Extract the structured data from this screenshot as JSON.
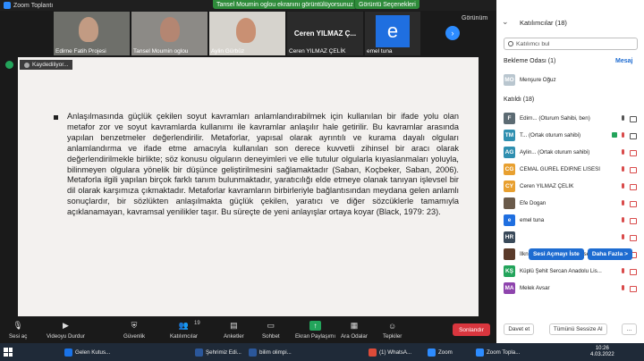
{
  "window": {
    "title": "Zoom Toplantı"
  },
  "banner": {
    "share_text": "Tansel Moumin oglou ekranını görüntülüyorsunuz",
    "view_options": "Görüntü Seçenekleri"
  },
  "thumbnails": [
    {
      "name": "Edirne Fatih Projesi"
    },
    {
      "name": "Tansel Moumin oglou"
    },
    {
      "name": "Aylin Gürbüz"
    },
    {
      "name": "Ceren YILMAZ Ç...",
      "label": "Ceren YILMAZ ÇELİK"
    },
    {
      "name": "e",
      "label": "emel tuna"
    }
  ],
  "view_label": "Görünüm",
  "recording": "Kaydediliyor...",
  "document": {
    "paragraph": "Anlaşılmasında güçlük çekilen soyut kavramları anlamlandırabilmek için kullanılan bir ifade yolu olan metafor zor ve soyut kavramlarda kullanımı ile kavramlar anlaşılır hale getirilir. Bu kavramlar arasında yapılan benzetmeler değerlendirilir. Metaforlar, yapısal olarak ayrıntılı ve kurama dayalı olguları anlamlandırma ve ifade etme amacıyla kullanılan son derece kuvvetli zihinsel bir aracı olarak değerlendirilmekle birlikte; söz konusu olguların deneyimleri ve elle tutulur olgularla kıyaslanmaları yoluyla, bilinmeyen olgulara yönelik bir düşünce geliştirilmesini sağlamaktadır (Saban, Koçbeker, Saban, 2006). Metaforla ilgili yapılan birçok farklı tanım bulunmaktadır, yaratıcılığı elde etmeye olanak tanıyan işlevsel bir dil olarak karşımıza çıkmaktadır. Metaforlar kavramların birbirleriyle bağlantısından meydana gelen anlamlı sonuçlardır, bir sözlükten anlaşılmakta güçlük çekilen, yaratıcı ve diğer sözcüklerle tamamıyla açıklanamayan, kavramsal yenilikler taşır. Bu süreçte de yeni anlayışlar ortaya koyar (Black, 1979: 23)."
  },
  "toolbar": {
    "mute": "Sesi aç",
    "video": "Videoyu Durdur",
    "security": "Güvenlik",
    "participants": "Katılımcılar",
    "participants_count": "19",
    "polls": "Anketler",
    "chat": "Sohbet",
    "share": "Ekran Paylaşımı",
    "breakout": "Ara Odalar",
    "reactions": "Tepkiler",
    "end": "Sonlandır"
  },
  "panel": {
    "title": "Katılımcılar (18)",
    "search_placeholder": "Katılımcı bul",
    "waiting_room": "Bekleme Odası (1)",
    "message": "Mesaj",
    "waiting_person": {
      "initials": "MO",
      "name": "Menşure Oğuz"
    },
    "in_call": "Katıldı (18)",
    "participants": [
      {
        "initials": "F",
        "color": "#5c6b73",
        "name": "Edirn...   (Oturum Sahibi, ben)"
      },
      {
        "initials": "TM",
        "color": "#2f8fb0",
        "name": "T...   (Ortak oturum sahibi)"
      },
      {
        "initials": "AG",
        "color": "#2f8fb0",
        "name": "Aylin...   (Ortak oturum sahibi)"
      },
      {
        "initials": "CG",
        "color": "#e8a030",
        "name": "CEMAL GÜREL EDIRNE LİSESİ"
      },
      {
        "initials": "CY",
        "color": "#e8a030",
        "name": "Ceren YILMAZ ÇELİK"
      },
      {
        "initials": "",
        "color": "#6a5a4a",
        "name": "Efe Dogan"
      },
      {
        "initials": "e",
        "color": "#1f6fe0",
        "name": "emel tuna"
      },
      {
        "initials": "HR",
        "color": "#3a4a5a",
        "name": ""
      },
      {
        "initials": "",
        "color": "#5a3a2a",
        "name": "İlknur Ekinci Keşan Fen Lisesi"
      },
      {
        "initials": "KŞ",
        "color": "#23a45b",
        "name": "Küplü Şehit Sercan Anadolu Lis..."
      },
      {
        "initials": "MA",
        "color": "#8e44ad",
        "name": "Melek Avsar"
      }
    ],
    "ask_unmute": "Sesi Açmayı İste",
    "more": "Daha Fazla >",
    "invite": "Davet et",
    "mute_all": "Tümünü Sessize Al"
  },
  "taskbar": {
    "items": [
      {
        "label": "Gelen Kutus...",
        "color": "#1a73e8"
      },
      {
        "label": "Şehrimiz Edi...",
        "color": "#2b579a"
      },
      {
        "label": "bilim olimpi...",
        "color": "#2b579a"
      },
      {
        "label": "(1) WhatsA...",
        "color": "#dd4b39"
      },
      {
        "label": "Zoom",
        "color": "#2d8cff"
      },
      {
        "label": "Zoom Topla...",
        "color": "#2d8cff"
      }
    ],
    "time": "10:26",
    "date": "4.03.2022"
  }
}
